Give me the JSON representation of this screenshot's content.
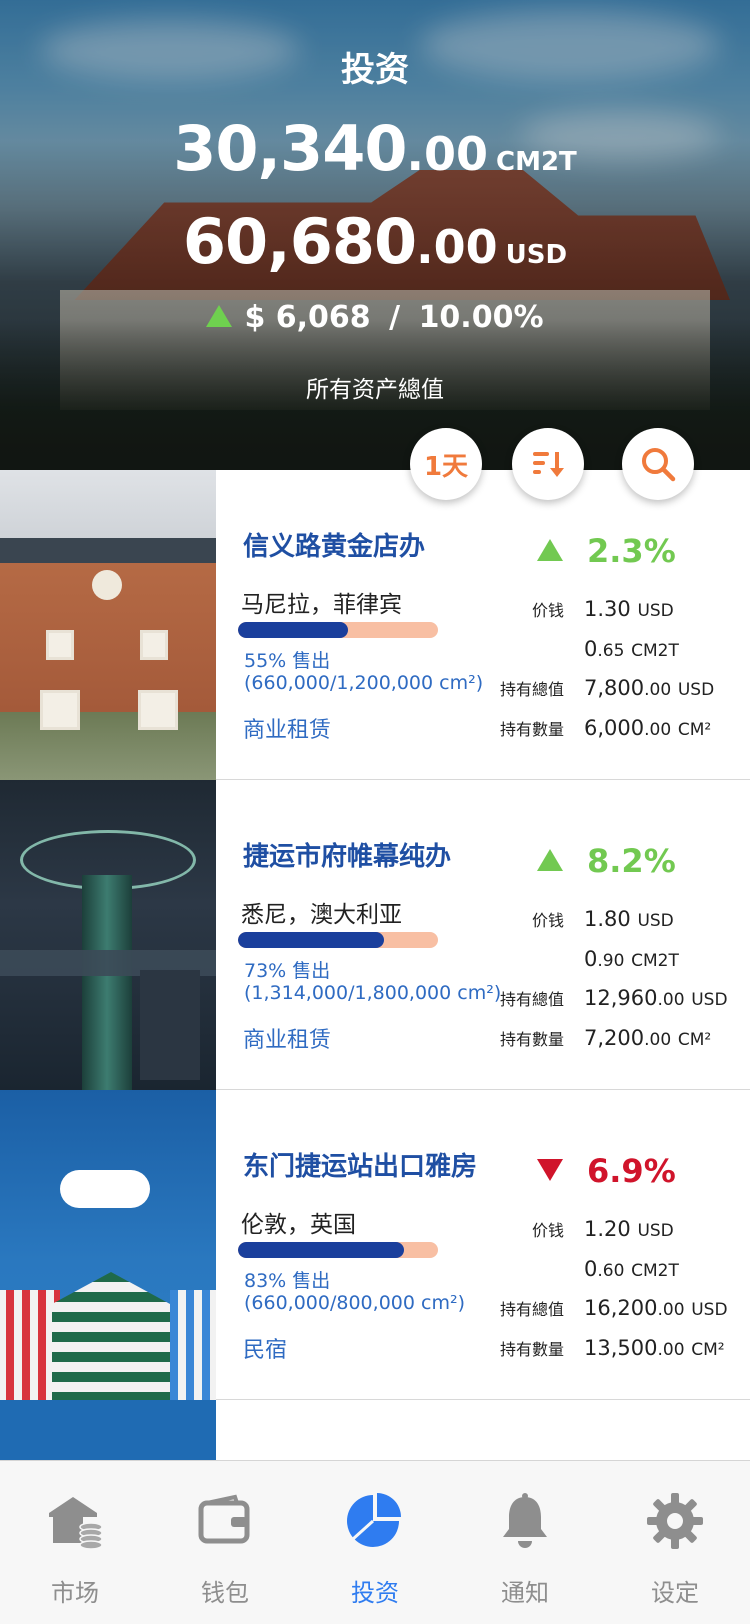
{
  "header": {
    "title": "投资",
    "total_cm2t_int": "30,340",
    "total_cm2t_dec": ".00",
    "total_cm2t_unit": "CM2T",
    "total_usd_int": "60,680",
    "total_usd_dec": ".00",
    "total_usd_unit": "USD",
    "change_amount": "$ 6,068",
    "change_sep": "/",
    "change_percent": "10.00%",
    "caption": "所有资产總值"
  },
  "actions": {
    "period_label": "1天",
    "sort_icon": "sort-desc-icon",
    "search_icon": "search-icon"
  },
  "labels": {
    "price": "价钱",
    "total_value": "持有總值",
    "quantity": "持有數量"
  },
  "properties": [
    {
      "name": "信义路黄金店办",
      "location": "马尼拉，菲律宾",
      "sold_fraction": 0.55,
      "sold_text": "55% 售出",
      "sold_detail": "(660,000/1,200,000 cm²)",
      "type": "商业租赁",
      "direction": "up",
      "change": "2.3%",
      "price_usd": "1.30",
      "price_usd_unit": "USD",
      "price_cm2t_int": "0",
      "price_cm2t_dec": ".65",
      "price_cm2t_unit": "CM2T",
      "value_int": "7,800",
      "value_dec": ".00",
      "value_unit": "USD",
      "qty_int": "6,000",
      "qty_dec": ".00",
      "qty_unit": "CM²"
    },
    {
      "name": "捷运市府帷幕纯办",
      "location": "悉尼，澳大利亚",
      "sold_fraction": 0.73,
      "sold_text": "73% 售出",
      "sold_detail": "(1,314,000/1,800,000 cm²)",
      "type": "商业租赁",
      "direction": "up",
      "change": "8.2%",
      "price_usd": "1.80",
      "price_usd_unit": "USD",
      "price_cm2t_int": "0",
      "price_cm2t_dec": ".90",
      "price_cm2t_unit": "CM2T",
      "value_int": "12,960",
      "value_dec": ".00",
      "value_unit": "USD",
      "qty_int": "7,200",
      "qty_dec": ".00",
      "qty_unit": "CM²"
    },
    {
      "name": "东门捷运站出口雅房",
      "location": "伦敦，英国",
      "sold_fraction": 0.83,
      "sold_text": "83% 售出",
      "sold_detail": "(660,000/800,000 cm²)",
      "type": "民宿",
      "direction": "down",
      "change": "6.9%",
      "price_usd": "1.20",
      "price_usd_unit": "USD",
      "price_cm2t_int": "0",
      "price_cm2t_dec": ".60",
      "price_cm2t_unit": "CM2T",
      "value_int": "16,200",
      "value_dec": ".00",
      "value_unit": "USD",
      "qty_int": "13,500",
      "qty_dec": ".00",
      "qty_unit": "CM²"
    }
  ],
  "tabs": [
    {
      "label": "市场",
      "icon": "market-icon",
      "active": false
    },
    {
      "label": "钱包",
      "icon": "wallet-icon",
      "active": false
    },
    {
      "label": "投资",
      "icon": "pie-chart-icon",
      "active": true
    },
    {
      "label": "通知",
      "icon": "bell-icon",
      "active": false
    },
    {
      "label": "设定",
      "icon": "gear-icon",
      "active": false
    }
  ],
  "colors": {
    "accent_orange": "#f07a3c",
    "up_green": "#72c951",
    "down_red": "#d0142b",
    "title_blue": "#1f4fa3",
    "link_blue": "#2f6bc2",
    "bar_fill": "#1a3f9c",
    "bar_track": "#f8bfa3",
    "tab_active": "#2f7cf0",
    "tab_inactive": "#8e8e8e"
  }
}
